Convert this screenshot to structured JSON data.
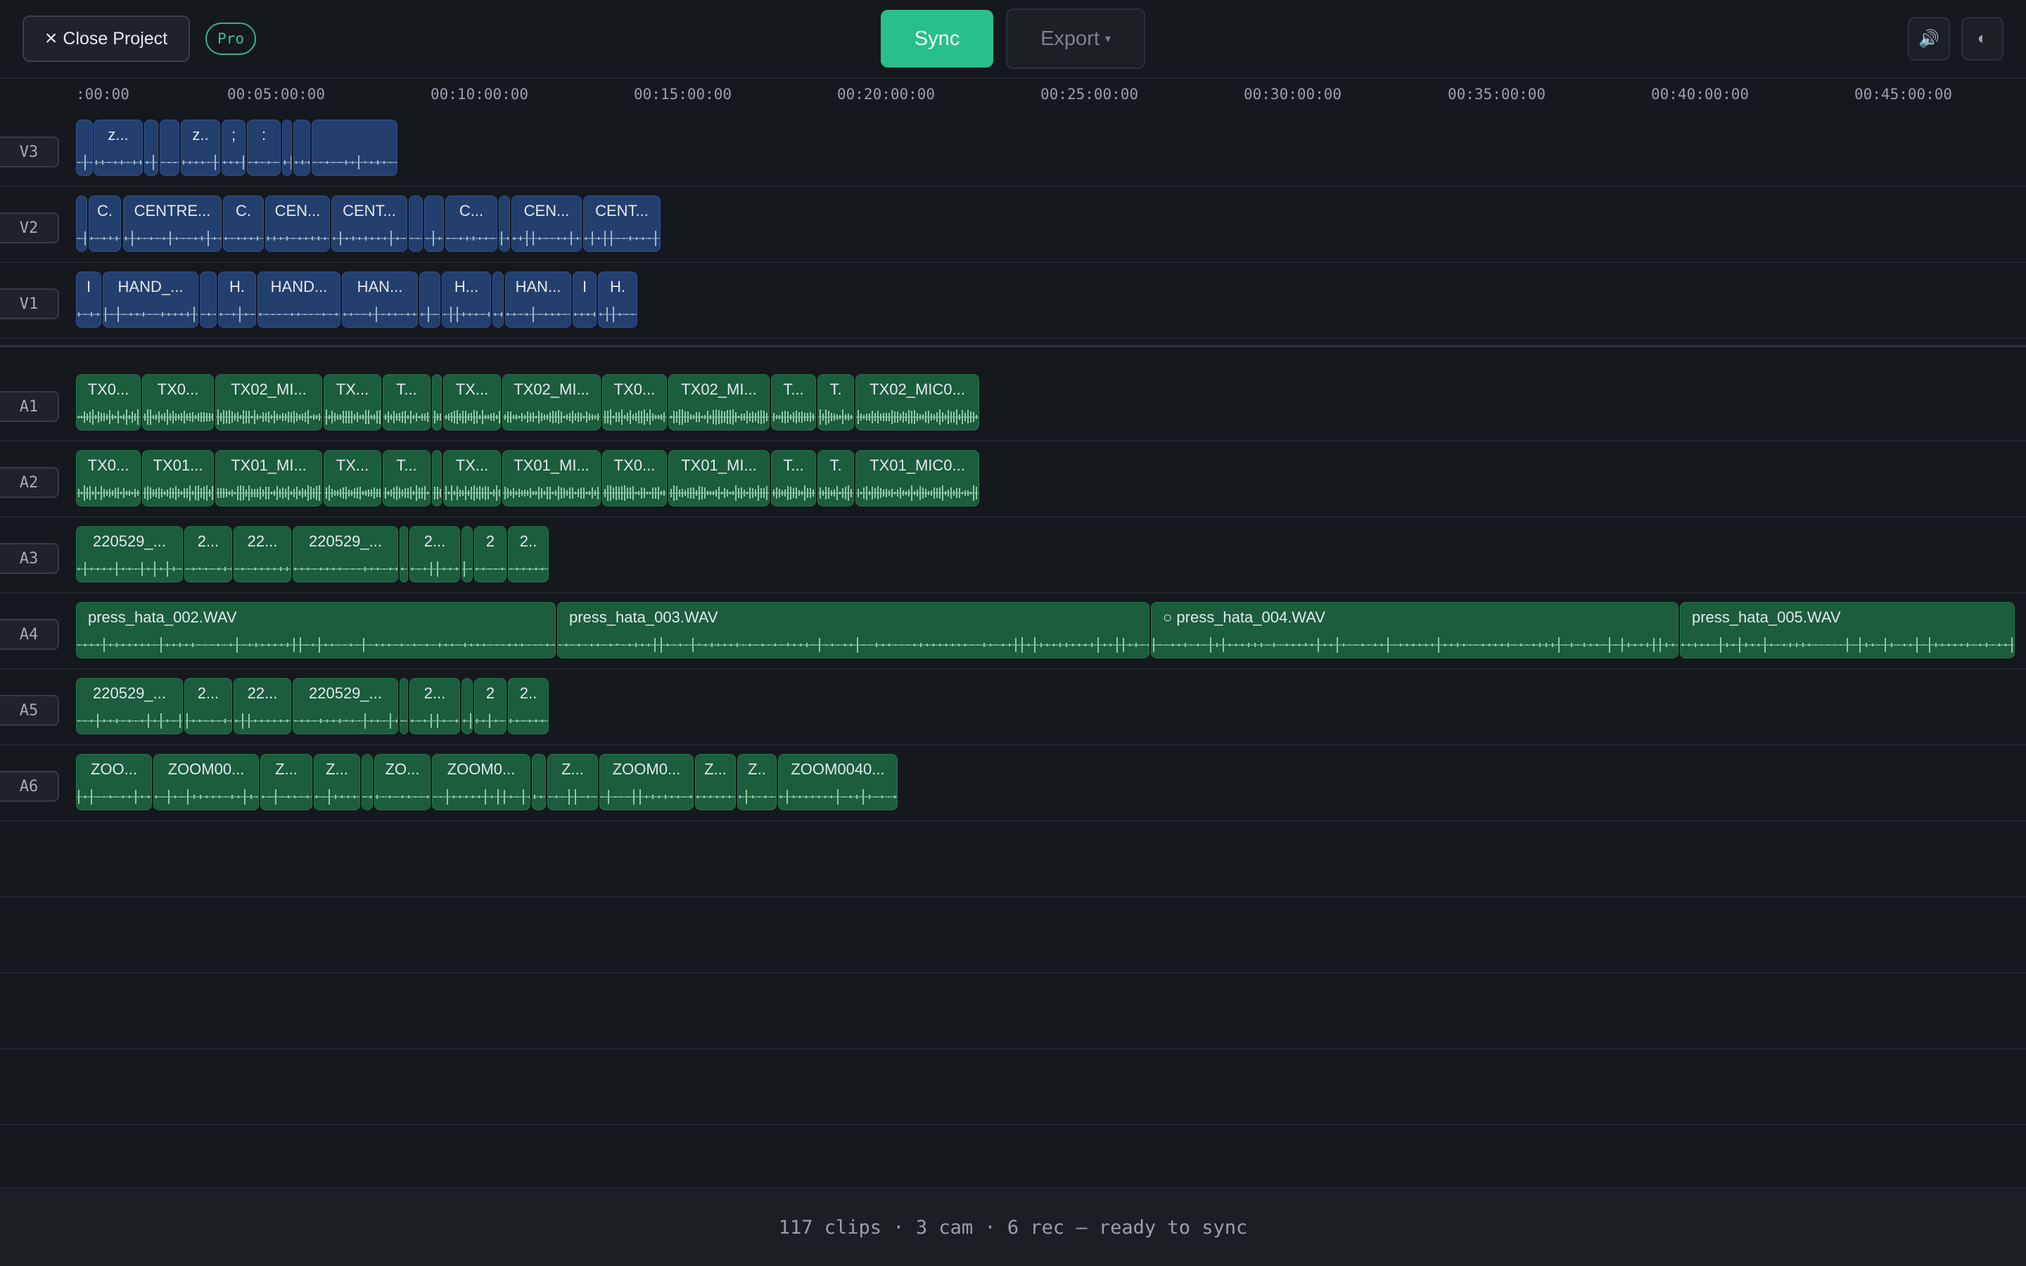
{
  "header": {
    "close_label": "Close Project",
    "pro_badge": "Pro",
    "sync_label": "Sync",
    "export_label": "Export",
    "volume_icon": "speaker-icon",
    "theme_icon": "half-circle-icon"
  },
  "ruler": {
    "ticks": [
      ":00:00",
      "00:05:00:00",
      "00:10:00:00",
      "00:15:00:00",
      "00:20:00:00",
      "00:25:00:00",
      "00:30:00:00",
      "00:35:00:00",
      "00:40:00:00",
      "00:45:00:00"
    ]
  },
  "video_tracks": [
    {
      "label": "V3",
      "clips": [
        {
          "name": ""
        },
        {
          "name": "z..."
        },
        {
          "name": ""
        },
        {
          "name": ""
        },
        {
          "name": "z.."
        },
        {
          "name": ";"
        },
        {
          "name": ":"
        },
        {
          "name": ""
        },
        {
          "name": ""
        },
        {
          "name": ""
        },
        {
          "name": ""
        }
      ]
    },
    {
      "label": "V2",
      "clips": [
        {
          "name": ""
        },
        {
          "name": "C."
        },
        {
          "name": "CENTRE..."
        },
        {
          "name": "C."
        },
        {
          "name": "CEN..."
        },
        {
          "name": "CENT..."
        },
        {
          "name": ""
        },
        {
          "name": ""
        },
        {
          "name": "C..."
        },
        {
          "name": ""
        },
        {
          "name": "CEN..."
        },
        {
          "name": "CENT..."
        }
      ]
    },
    {
      "label": "V1",
      "clips": [
        {
          "name": "I"
        },
        {
          "name": "HAND_..."
        },
        {
          "name": ""
        },
        {
          "name": "H."
        },
        {
          "name": "HAND..."
        },
        {
          "name": "HAN..."
        },
        {
          "name": ""
        },
        {
          "name": "H..."
        },
        {
          "name": ""
        },
        {
          "name": "HAN..."
        },
        {
          "name": "I"
        },
        {
          "name": "H."
        }
      ]
    }
  ],
  "audio_tracks": [
    {
      "label": "A1",
      "clips": [
        {
          "name": "TX0..."
        },
        {
          "name": "TX0..."
        },
        {
          "name": "TX02_MI..."
        },
        {
          "name": "TX..."
        },
        {
          "name": "T..."
        },
        {
          "name": ""
        },
        {
          "name": "TX..."
        },
        {
          "name": "TX02_MI..."
        },
        {
          "name": "TX0..."
        },
        {
          "name": "TX02_MI..."
        },
        {
          "name": "T..."
        },
        {
          "name": "T."
        },
        {
          "name": "TX02_MIC0..."
        }
      ]
    },
    {
      "label": "A2",
      "clips": [
        {
          "name": "TX0..."
        },
        {
          "name": "TX01..."
        },
        {
          "name": "TX01_MI..."
        },
        {
          "name": "TX..."
        },
        {
          "name": "T..."
        },
        {
          "name": ""
        },
        {
          "name": "TX..."
        },
        {
          "name": "TX01_MI..."
        },
        {
          "name": "TX0..."
        },
        {
          "name": "TX01_MI..."
        },
        {
          "name": "T..."
        },
        {
          "name": "T."
        },
        {
          "name": "TX01_MIC0..."
        }
      ]
    },
    {
      "label": "A3",
      "clips": [
        {
          "name": "220529_..."
        },
        {
          "name": "2..."
        },
        {
          "name": "22..."
        },
        {
          "name": "220529_..."
        },
        {
          "name": ""
        },
        {
          "name": "2..."
        },
        {
          "name": ""
        },
        {
          "name": "2"
        },
        {
          "name": "2.."
        }
      ]
    },
    {
      "label": "A4",
      "clips": [
        {
          "name": "press_hata_002.WAV"
        },
        {
          "name": "press_hata_003.WAV"
        },
        {
          "name": "○ press_hata_004.WAV"
        },
        {
          "name": "press_hata_005.WAV"
        }
      ]
    },
    {
      "label": "A5",
      "clips": [
        {
          "name": "220529_..."
        },
        {
          "name": "2..."
        },
        {
          "name": "22..."
        },
        {
          "name": "220529_..."
        },
        {
          "name": ""
        },
        {
          "name": "2..."
        },
        {
          "name": ""
        },
        {
          "name": "2"
        },
        {
          "name": "2.."
        }
      ]
    },
    {
      "label": "A6",
      "clips": [
        {
          "name": "ZOO..."
        },
        {
          "name": "ZOOM00..."
        },
        {
          "name": "Z..."
        },
        {
          "name": "Z..."
        },
        {
          "name": ""
        },
        {
          "name": "ZO..."
        },
        {
          "name": "ZOOM0..."
        },
        {
          "name": ""
        },
        {
          "name": "Z..."
        },
        {
          "name": "ZOOM0..."
        },
        {
          "name": "Z..."
        },
        {
          "name": "Z.."
        },
        {
          "name": "ZOOM0040..."
        }
      ]
    }
  ],
  "footer": {
    "status": "117 clips · 3 cam · 6 rec — ready to sync"
  },
  "colors": {
    "accent": "#27c08a",
    "video_clip": "#233f6e",
    "audio_clip": "#1b5d3d",
    "background": "#15181d"
  }
}
